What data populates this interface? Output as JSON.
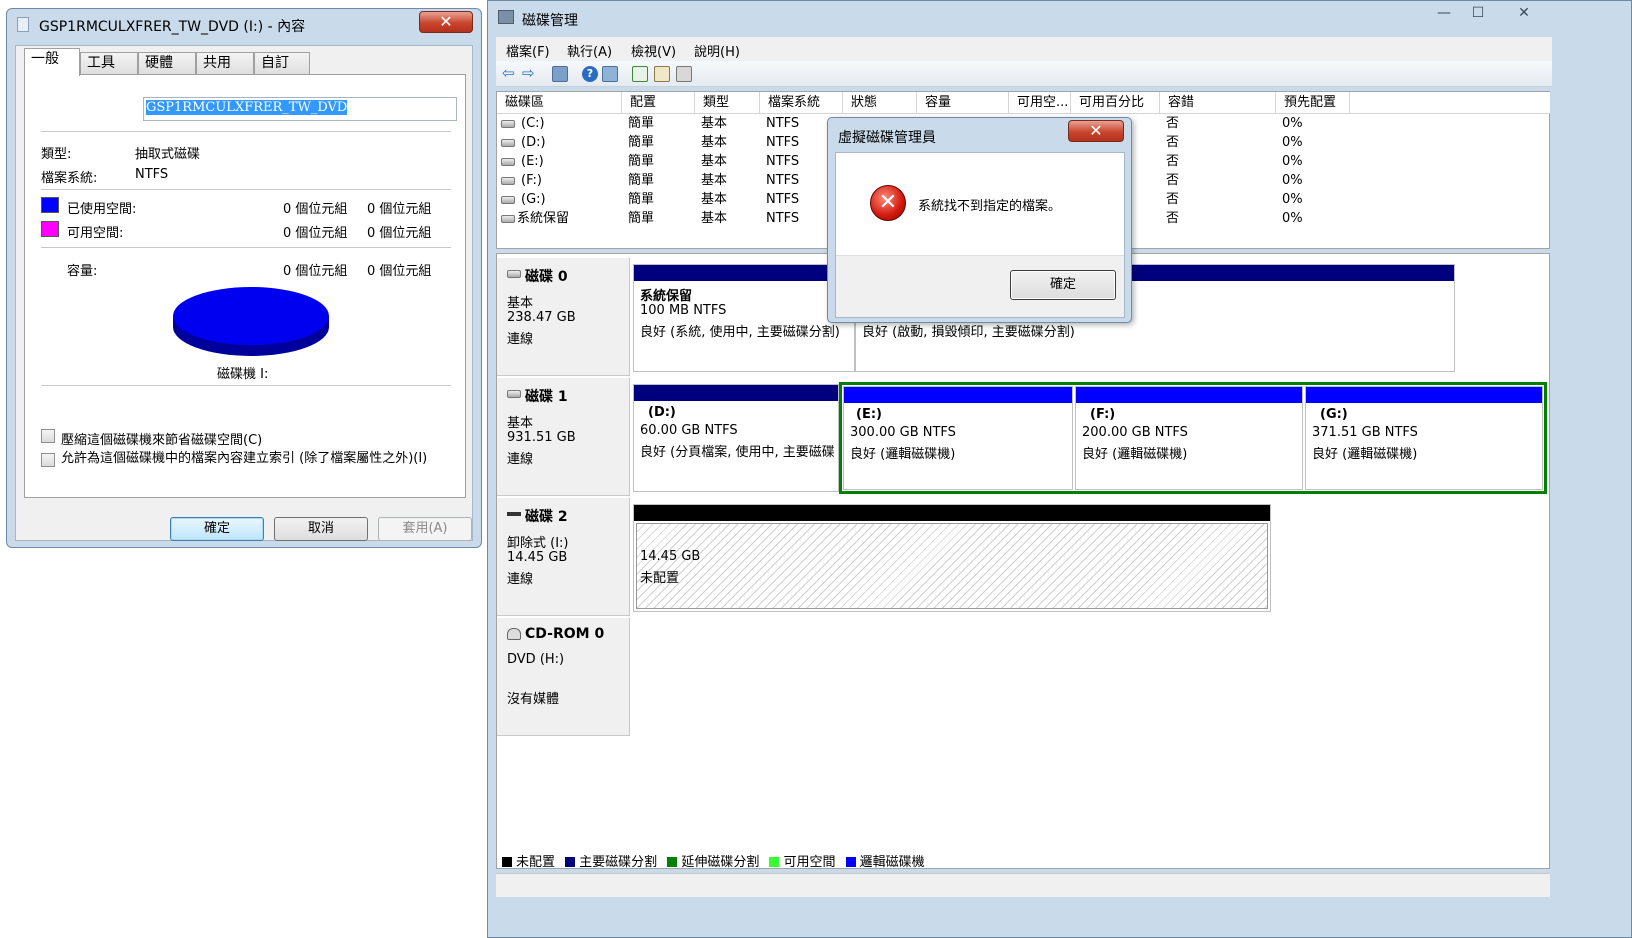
{
  "props": {
    "title": "GSP1RMCULXFRER_TW_DVD (I:) - 內容",
    "close": "✕",
    "tabs": [
      "一般",
      "工具",
      "硬體",
      "共用",
      "自訂"
    ],
    "name_value": "GSP1RMCULXFRER_TW_DVD",
    "type_label": "類型:",
    "type_value": "抽取式磁碟",
    "fs_label": "檔案系統:",
    "fs_value": "NTFS",
    "used_label": "已使用空間:",
    "used_bytes": "0 個位元組",
    "used_size": "0 個位元組",
    "free_label": "可用空間:",
    "free_bytes": "0 個位元組",
    "free_size": "0 個位元組",
    "cap_label": "容量:",
    "cap_bytes": "0 個位元組",
    "cap_size": "0 個位元組",
    "drive_label": "磁碟機 I:",
    "compress_label": "壓縮這個磁碟機來節省磁碟空間(C)",
    "index_label": "允許為這個磁碟機中的檔案內容建立索引 (除了檔案屬性之外)(I)",
    "ok": "確定",
    "cancel": "取消",
    "apply": "套用(A)",
    "colors": {
      "used": "#0000ff",
      "free": "#ff00ff",
      "pie": "#0000f0",
      "pie_side": "#00009a"
    }
  },
  "dm": {
    "title": "磁碟管理",
    "controls": [
      "—",
      "☐",
      "✕"
    ],
    "menu": [
      "檔案(F)",
      "執行(A)",
      "檢視(V)",
      "說明(H)"
    ],
    "columns": [
      "磁碟區",
      "配置",
      "類型",
      "檔案系統",
      "狀態",
      "容量",
      "可用空...",
      "可用百分比",
      "容錯",
      "預先配置"
    ],
    "volumes": [
      {
        "name": "(C:)",
        "layout": "簡單",
        "type": "基本",
        "fs": "NTFS",
        "fault": "否",
        "overhead": "0%"
      },
      {
        "name": "(D:)",
        "layout": "簡單",
        "type": "基本",
        "fs": "NTFS",
        "fault": "否",
        "overhead": "0%"
      },
      {
        "name": "(E:)",
        "layout": "簡單",
        "type": "基本",
        "fs": "NTFS",
        "fault": "否",
        "overhead": "0%"
      },
      {
        "name": "(F:)",
        "layout": "簡單",
        "type": "基本",
        "fs": "NTFS",
        "fault": "否",
        "overhead": "0%"
      },
      {
        "name": "(G:)",
        "layout": "簡單",
        "type": "基本",
        "fs": "NTFS",
        "fault": "否",
        "overhead": "0%"
      },
      {
        "name": "系統保留",
        "layout": "簡單",
        "type": "基本",
        "fs": "NTFS",
        "fault": "否",
        "overhead": "0%"
      }
    ],
    "disks": {
      "d0": {
        "name": "磁碟 0",
        "kind": "基本",
        "size": "238.47 GB",
        "state": "連線"
      },
      "d1": {
        "name": "磁碟 1",
        "kind": "基本",
        "size": "931.51 GB",
        "state": "連線"
      },
      "d2": {
        "name": "磁碟 2",
        "kind": "卸除式 (I:)",
        "size": "14.45 GB",
        "state": "連線"
      },
      "cd": {
        "name": "CD-ROM 0",
        "kind": "DVD (H:)",
        "state": "沒有媒體"
      }
    },
    "parts": {
      "sysres": {
        "t1": "系統保留",
        "t2": "100 MB NTFS",
        "t3": "良好 (系統, 使用中, 主要磁碟分割)"
      },
      "c": {
        "t3": "良好 (啟動, 損毀傾印, 主要磁碟分割)"
      },
      "d": {
        "t1": "(D:)",
        "t2": "60.00 GB NTFS",
        "t3": "良好 (分頁檔案, 使用中, 主要磁碟分割)"
      },
      "e": {
        "t1": "(E:)",
        "t2": "300.00 GB NTFS",
        "t3": "良好 (邏輯磁碟機)"
      },
      "f": {
        "t1": "(F:)",
        "t2": "200.00 GB NTFS",
        "t3": "良好 (邏輯磁碟機)"
      },
      "g": {
        "t1": "(G:)",
        "t2": "371.51 GB NTFS",
        "t3": "良好 (邏輯磁碟機)"
      },
      "i": {
        "t2": "14.45 GB",
        "t3": "未配置"
      }
    },
    "legend": [
      {
        "label": "未配置",
        "color": "#000000"
      },
      {
        "label": "主要磁碟分割",
        "color": "#00007f"
      },
      {
        "label": "延伸磁碟分割",
        "color": "#008000"
      },
      {
        "label": "可用空間",
        "color": "#33ff33"
      },
      {
        "label": "邏輯磁碟機",
        "color": "#0000ff"
      }
    ]
  },
  "msg": {
    "title": "虛擬磁碟管理員",
    "close": "✕",
    "text": "系統找不到指定的檔案。",
    "ok": "確定"
  }
}
